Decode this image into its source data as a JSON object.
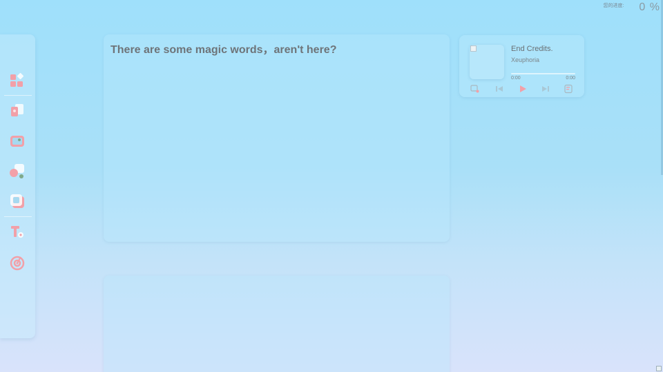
{
  "progress": {
    "label": "您的进度:",
    "value": "0 %"
  },
  "sidebar": {
    "items": [
      {
        "icon": "apps-grid-icon"
      },
      {
        "icon": "cards-icon"
      },
      {
        "icon": "image-frame-icon"
      },
      {
        "icon": "shapes-icon"
      },
      {
        "icon": "layers-icon"
      },
      {
        "icon": "text-tool-icon"
      },
      {
        "icon": "target-icon"
      }
    ]
  },
  "main_card": {
    "title": "There are some magic words，aren't here?"
  },
  "player": {
    "song_title": "End Credits.",
    "artist": "Xeuphoria",
    "current_time": "0:00",
    "total_time": "0:00",
    "progress": 0,
    "controls": [
      "playlist-icon",
      "previous-icon",
      "play-icon",
      "next-icon",
      "lyrics-icon"
    ]
  },
  "colors": {
    "accent": "#f2a0a8",
    "icon_secondary": "#a7d9f0"
  }
}
